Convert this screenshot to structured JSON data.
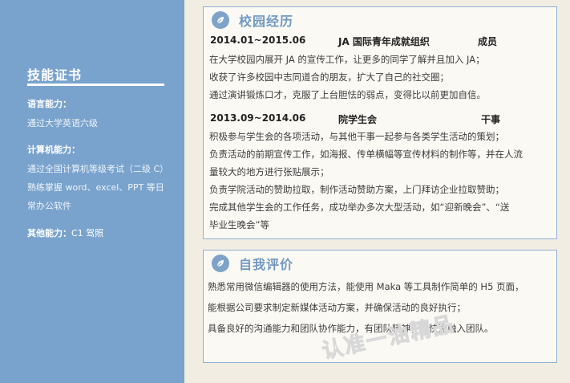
{
  "sidebar": {
    "skills_title": "技能证书",
    "language_label": "语言能力：",
    "language_value": "通过大学英语六级",
    "computer_label": "计算机能力：",
    "computer_lines": [
      "通过全国计算机等级考试（二级 C）",
      "熟练掌握 word、excel、PPT 等日",
      "常办公软件"
    ],
    "other_label": "其他能力：",
    "other_value": "C1 驾照"
  },
  "campus": {
    "title": "校园经历",
    "icon": "leaf-icon",
    "entries": [
      {
        "period": "2014.01~2015.06",
        "org": "JA 国际青年成就组织",
        "role": "成员",
        "lines": [
          "在大学校园内展开 JA 的宣传工作，让更多的同学了解并且加入 JA；",
          "收获了许多校园中志同道合的朋友，扩大了自己的社交圈；",
          "通过演讲锻炼口才，克服了上台胆怯的弱点，变得比以前更加自信。"
        ]
      },
      {
        "period": "2013.09~2014.06",
        "org": "院学生会",
        "role": "干事",
        "lines": [
          "积极参与学生会的各项活动，与其他干事一起参与各类学生活动的策划；",
          "负责活动的前期宣传工作，如海报、传单横幅等宣传材料的制作等，并在人流",
          "量较大的地方进行张贴展示；",
          "负责学院活动的赞助拉取，制作活动赞助方案，上门拜访企业拉取赞助；",
          "完成其他学生会的工作任务，成功举办多次大型活动，如“迎新晚会”、“送",
          "毕业生晚会”等"
        ]
      }
    ]
  },
  "self_eval": {
    "title": "自我评价",
    "icon": "leaf-icon",
    "lines": [
      "熟悉常用微信编辑器的使用方法，能使用 Maka 等工具制作简单的 H5 页面，",
      "能根据公司要求制定新媒体活动方案，并确保活动的良好执行；",
      "具备良好的沟通能力和团队协作能力，有团队精神，能快速融入团队。"
    ]
  },
  "watermark": "认准一油精品",
  "colors": {
    "sidebar": "#79a3cd",
    "accent": "#6f98c3",
    "page": "#f1ede3"
  }
}
